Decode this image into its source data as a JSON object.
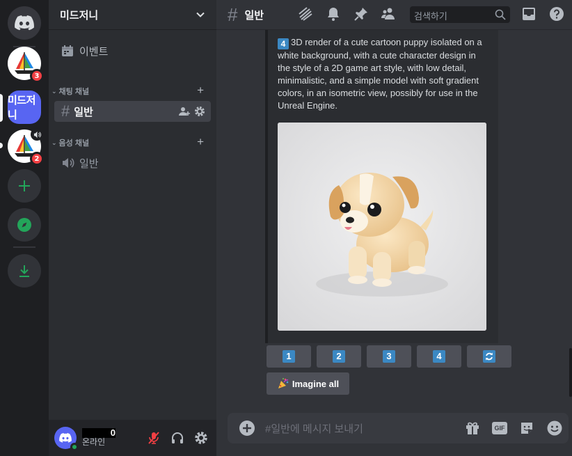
{
  "servers": {
    "badge_1": "3",
    "badge_2": "2",
    "active_label": "미드저니"
  },
  "sidebar": {
    "server_name": "미드저니",
    "events_label": "이벤트",
    "text_category": "채팅 채널",
    "voice_category": "음성 채널",
    "text_channel": "일반",
    "voice_channel": "일반"
  },
  "user": {
    "name": "0",
    "status": "온라인"
  },
  "header": {
    "channel_name": "일반",
    "search_placeholder": "검색하기"
  },
  "message": {
    "prompt_index": "4",
    "prompt_text": "3D render of a cute cartoon puppy isolated on a white background, with a cute character design in the style of a 2D game art style, with low detail, minimalistic, and a simple model with soft gradient colors, in an isometric view, possibly for use in the Unreal Engine."
  },
  "actions": {
    "buttons": [
      "1",
      "2",
      "3",
      "4"
    ],
    "imagine_all": "Imagine all"
  },
  "composer": {
    "placeholder": "#일반에 메시지 보내기",
    "gif_label": "GIF"
  },
  "colors": {
    "blurple": "#5865f2",
    "green": "#23a55a",
    "red": "#f23f43",
    "keycap_blue": "#3b88c3"
  }
}
